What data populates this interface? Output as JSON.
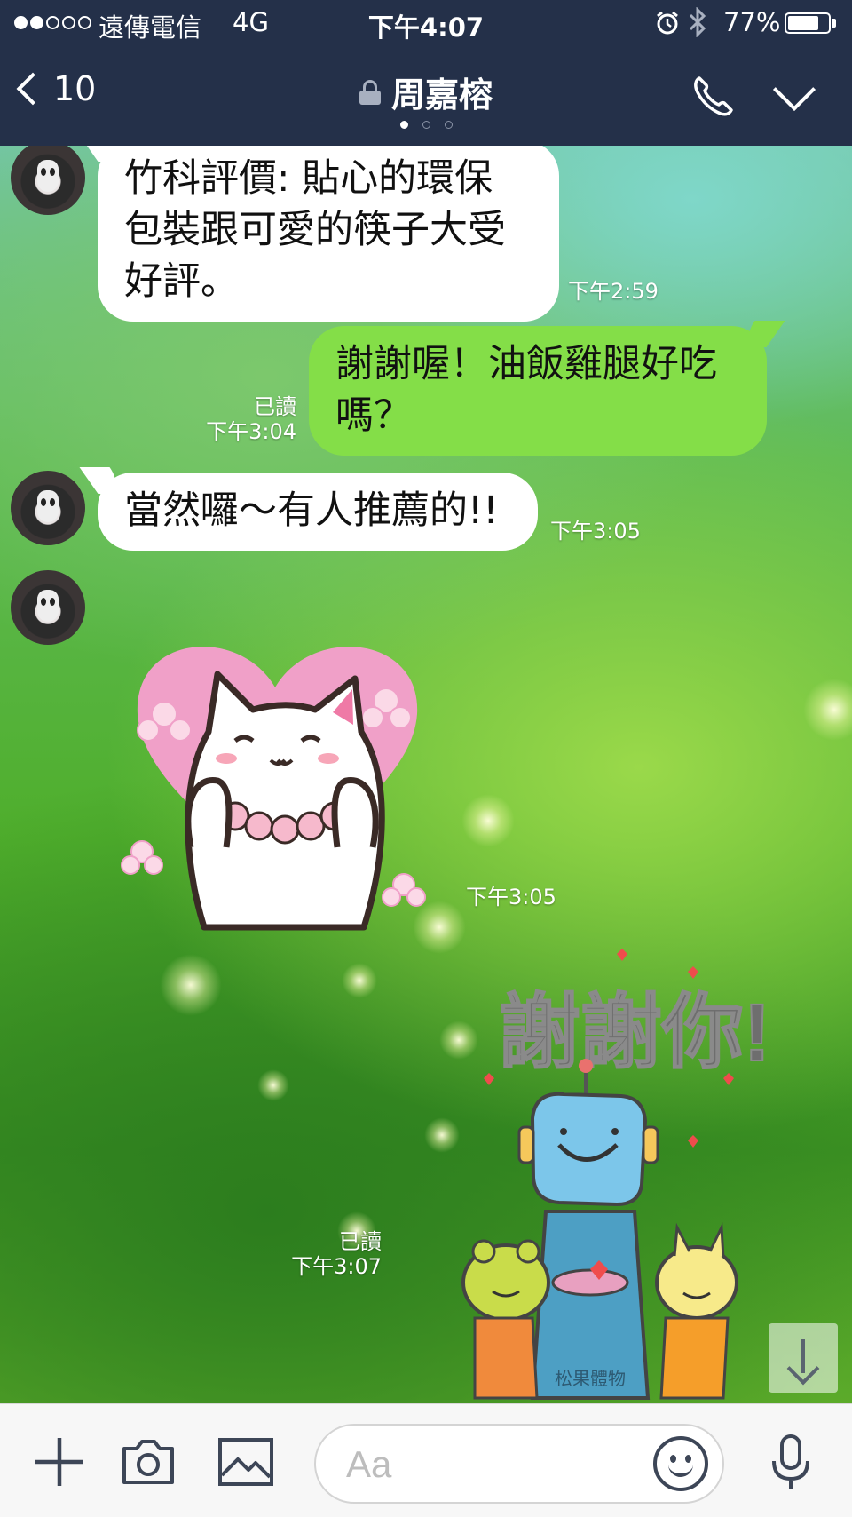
{
  "status_bar": {
    "carrier": "遠傳電信",
    "network": "4G",
    "time": "下午4:07",
    "battery_percent": "77%",
    "battery_level": 0.77,
    "signal_strength": 2,
    "icons": [
      "alarm-icon",
      "bluetooth-icon",
      "battery-icon"
    ]
  },
  "header": {
    "unread_count": "10",
    "title": "周嘉榕",
    "page_indicator": {
      "total": 3,
      "current": 1
    },
    "icons": [
      "back-chevron-icon",
      "lock-icon",
      "phone-icon",
      "chevron-down-icon"
    ]
  },
  "messages": [
    {
      "direction": "incoming",
      "type": "text",
      "text": "竹科評價: 貼心的環保\n包裝跟可愛的筷子大受\n好評。",
      "time": "下午2:59"
    },
    {
      "direction": "outgoing",
      "type": "text",
      "text": "謝謝喔！油飯雞腿好吃\n嗎？",
      "read": "已讀",
      "time": "下午3:04"
    },
    {
      "direction": "incoming",
      "type": "text",
      "text": "當然囉～有人推薦的!!",
      "time": "下午3:05"
    },
    {
      "direction": "incoming",
      "type": "sticker",
      "sticker": "white-cat-heart-sticker",
      "time": "下午3:05"
    },
    {
      "direction": "outgoing",
      "type": "sticker",
      "sticker": "robot-thank-you-sticker",
      "sticker_text": "謝謝你!",
      "sticker_brand": "松果體物",
      "read": "已讀",
      "time": "下午3:07"
    }
  ],
  "input_bar": {
    "placeholder": "Aa",
    "icons": [
      "plus-icon",
      "camera-icon",
      "image-icon",
      "emoji-icon",
      "microphone-icon"
    ]
  },
  "colors": {
    "header_bg": "#243049",
    "outgoing_bubble": "#84de48",
    "incoming_bubble": "#ffffff"
  }
}
